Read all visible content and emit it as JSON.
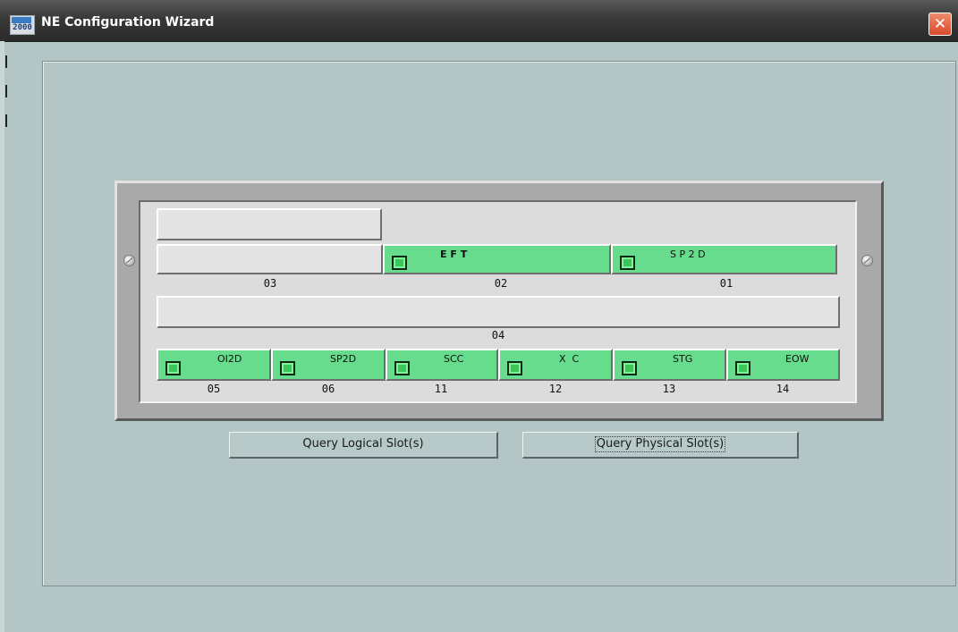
{
  "window": {
    "title": "NE Configuration Wizard",
    "app_icon_text": "2000",
    "close_glyph": "✕"
  },
  "buttons": {
    "query_logical": "Query Logical Slot(s)",
    "query_physical": "Query Physical Slot(s)"
  },
  "slots": {
    "s03": {
      "number": "03",
      "label": ""
    },
    "s02": {
      "number": "02",
      "label": "E F T",
      "status": "green"
    },
    "s01": {
      "number": "01",
      "label": "S P 2 D",
      "status": "green"
    },
    "s04": {
      "number": "04",
      "label": ""
    },
    "s05": {
      "number": "05",
      "label": "OI2D",
      "status": "green"
    },
    "s06": {
      "number": "06",
      "label": "SP2D",
      "status": "green"
    },
    "s11": {
      "number": "11",
      "label": "SCC",
      "status": "green"
    },
    "s12": {
      "number": "12",
      "label": "X  C",
      "status": "green"
    },
    "s13": {
      "number": "13",
      "label": "STG",
      "status": "green"
    },
    "s14": {
      "number": "14",
      "label": "EOW",
      "status": "green"
    }
  },
  "colors": {
    "background": "#b3c5c5",
    "card_active": "#66dc8c",
    "led": "#3ec55a",
    "slot_empty": "#e4e4e4"
  }
}
